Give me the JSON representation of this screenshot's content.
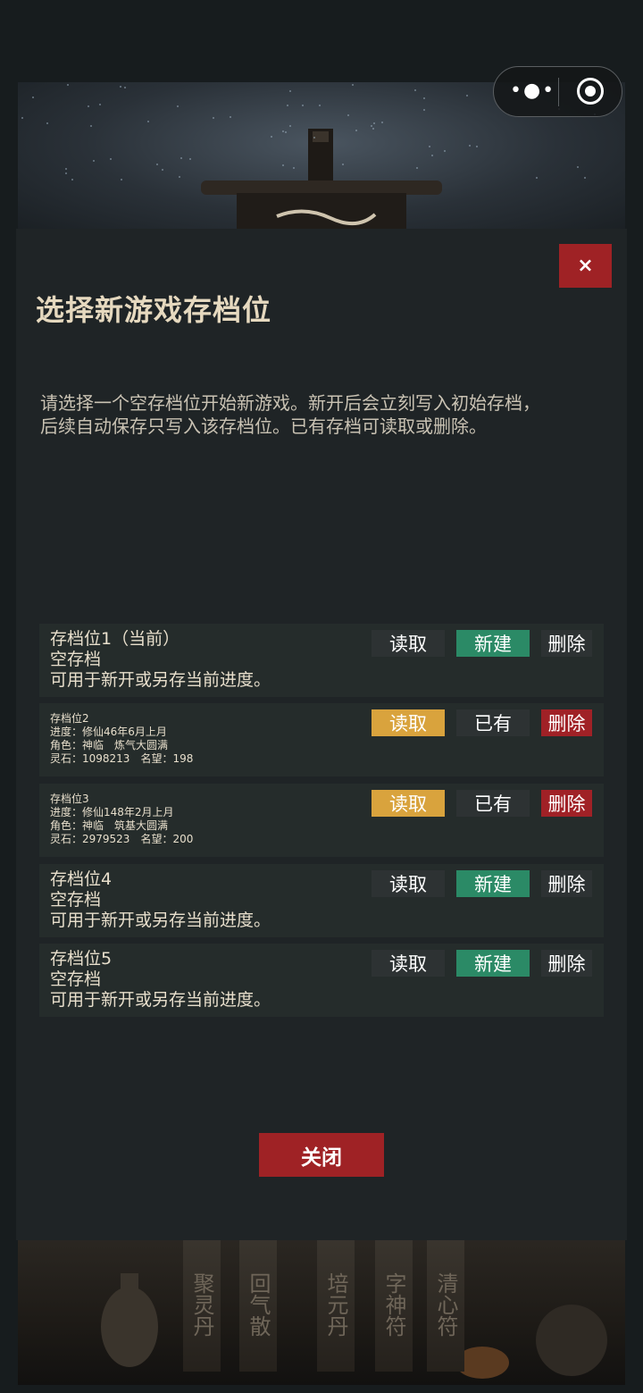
{
  "modal": {
    "close_icon": "×",
    "title": "选择新游戏存档位",
    "description_lines": [
      "请选择一个空存档位开始新游戏。新开后会立刻写入初始存档，",
      "后续自动保存只写入该存档位。已有存档可读取或删除。"
    ],
    "slots": [
      {
        "lines": [
          "存档位1（当前）",
          "空存档",
          "可用于新开或另存当前进度。"
        ],
        "read_label": "读取",
        "action_label": "新建",
        "delete_label": "删除"
      },
      {
        "lines": [
          "存档位2",
          "进度：修仙46年6月上月",
          "角色：神临　炼气大圆满",
          "灵石：1098213　名望：198"
        ],
        "read_label": "读取",
        "action_label": "已有",
        "delete_label": "删除"
      },
      {
        "lines": [
          "存档位3",
          "进度：修仙148年2月上月",
          "角色：神临　筑基大圆满",
          "灵石：2979523　名望：200"
        ],
        "read_label": "读取",
        "action_label": "已有",
        "delete_label": "删除"
      },
      {
        "lines": [
          "存档位4",
          "空存档",
          "可用于新开或另存当前进度。"
        ],
        "read_label": "读取",
        "action_label": "新建",
        "delete_label": "删除"
      },
      {
        "lines": [
          "存档位5",
          "空存档",
          "可用于新开或另存当前进度。"
        ],
        "read_label": "读取",
        "action_label": "新建",
        "delete_label": "删除"
      }
    ],
    "close_label": "关闭"
  },
  "background_bottom_tags": [
    "聚灵丹",
    "回气散",
    "培元丹",
    "字神符",
    "清心符"
  ],
  "colors": {
    "danger": "#9f2225",
    "new": "#2b8a66",
    "read_active": "#d9a33d",
    "panel": "#1f2426",
    "slot": "#252c2b"
  }
}
